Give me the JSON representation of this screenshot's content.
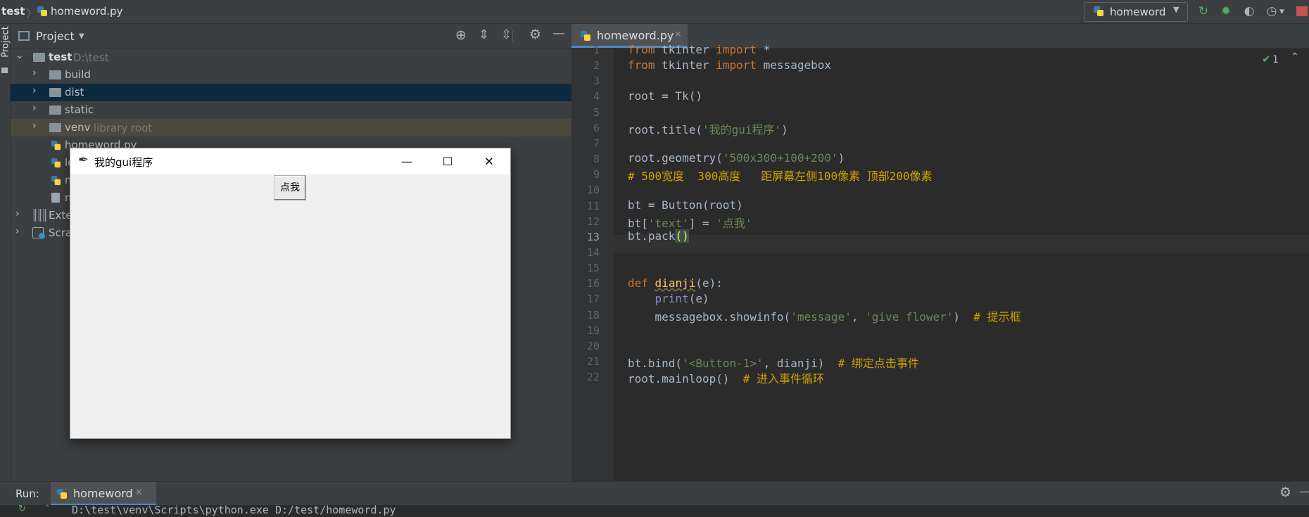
{
  "navbar": {
    "project": "test",
    "file": "homeword.py",
    "run_config": "homeword"
  },
  "left_strip": {
    "label": "Project"
  },
  "project_panel": {
    "title": "Project",
    "tree": [
      {
        "name": "test",
        "sub": "D:\\test",
        "level": 0,
        "type": "folder",
        "expanded": true
      },
      {
        "name": "build",
        "sub": "",
        "level": 1,
        "type": "folder",
        "expanded": false
      },
      {
        "name": "dist",
        "sub": "",
        "level": 1,
        "type": "folder",
        "expanded": false
      },
      {
        "name": "static",
        "sub": "",
        "level": 1,
        "type": "folder",
        "expanded": false
      },
      {
        "name": "venv",
        "sub": "library root",
        "level": 1,
        "type": "folder",
        "expanded": false
      },
      {
        "name": "homeword.py",
        "sub": "",
        "level": 1,
        "type": "file"
      },
      {
        "name": "le",
        "sub": "",
        "level": 1,
        "type": "file"
      },
      {
        "name": "m",
        "sub": "",
        "level": 1,
        "type": "file"
      },
      {
        "name": "m",
        "sub": "",
        "level": 1,
        "type": "file"
      },
      {
        "name": "Exte",
        "sub": "",
        "level": 0,
        "type": "lib"
      },
      {
        "name": "Scra",
        "sub": "",
        "level": 0,
        "type": "scratch"
      }
    ]
  },
  "editor": {
    "tab": "homeword.py",
    "inspection_count": "1",
    "lines": [
      "1",
      "2",
      "3",
      "4",
      "5",
      "6",
      "7",
      "8",
      "9",
      "10",
      "11",
      "12",
      "13",
      "14",
      "15",
      "16",
      "17",
      "18",
      "19",
      "20",
      "21",
      "22"
    ]
  },
  "run": {
    "label": "Run:",
    "tab": "homeword",
    "console_line": "D:\\test\\venv\\Scripts\\python.exe D:/test/homeword.py"
  },
  "tk_window": {
    "title": "我的gui程序",
    "button": "点我"
  },
  "colors": {
    "bg": "#2b2b2b",
    "panel": "#3c3f41",
    "selection": "#0d293e",
    "venv_row": "#4b4940",
    "accent": "#4a88c7"
  }
}
